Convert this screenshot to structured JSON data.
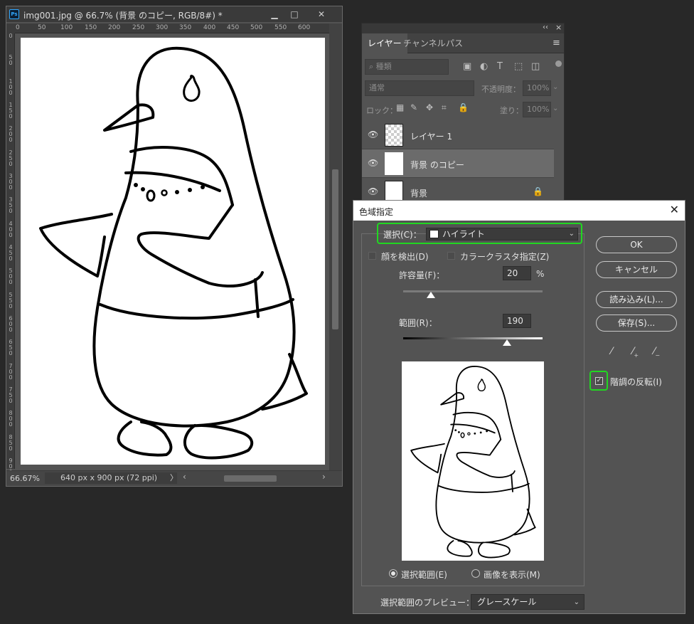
{
  "document": {
    "title": "img001.jpg @ 66.7% (背景 のコピー, RGB/8#) *",
    "app_icon": "Ps",
    "ruler_top": [
      "0",
      "50",
      "100",
      "150",
      "200",
      "250",
      "300",
      "350",
      "400",
      "450",
      "500",
      "550",
      "600"
    ],
    "ruler_left": [
      "0",
      "50",
      "100",
      "150",
      "200",
      "250",
      "300",
      "350",
      "400",
      "450",
      "500",
      "550",
      "600",
      "650",
      "700",
      "750",
      "800",
      "850",
      "900"
    ],
    "zoom": "66.67%",
    "info": "640 px x 900 px (72 ppi)",
    "info_arrow": "〉",
    "hscroll_left": "‹",
    "hscroll_right": "›"
  },
  "layers_panel": {
    "collapse": "‹‹",
    "close": "×",
    "tabs": [
      "レイヤー",
      "チャンネル",
      "パス"
    ],
    "menu": "≡",
    "filter_placeholder": "種類",
    "blend_mode": "通常",
    "opacity_label": "不透明度：",
    "opacity_value": "100%",
    "lock_label": "ロック：",
    "fill_label": "塗り：",
    "fill_value": "100%",
    "layers": [
      {
        "name": "レイヤー 1"
      },
      {
        "name": "背景 のコピー"
      },
      {
        "name": "背景"
      }
    ]
  },
  "dialog": {
    "title": "色域指定",
    "close": "✕",
    "select_label": "選択(C)：",
    "select_value": "ハイライト",
    "detect_faces": "顔を検出(D)",
    "localized_clusters": "カラークラスタ指定(Z)",
    "fuzziness_label": "許容量(F)：",
    "fuzziness_value": "20",
    "fuzziness_unit": "%",
    "fuzziness_level": 0.2,
    "range_label": "範囲(R)：",
    "range_value": "190",
    "range_level": 0.745,
    "radio_selection": "選択範囲(E)",
    "radio_image": "画像を表示(M)",
    "preview_label": "選択範囲のプレビュー：",
    "preview_value": "グレースケール",
    "buttons": {
      "ok": "OK",
      "cancel": "キャンセル",
      "load": "読み込み(L)...",
      "save": "保存(S)..."
    },
    "invert_label": "階調の反転(I)",
    "invert_mark": "✓",
    "accent": "#21d721"
  }
}
